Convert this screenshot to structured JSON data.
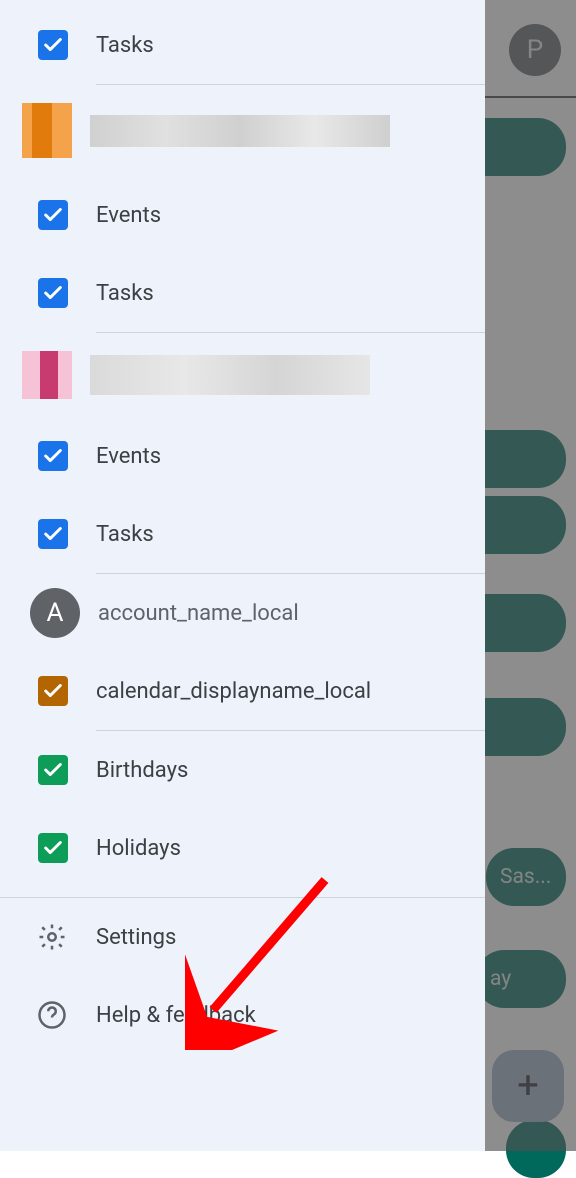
{
  "background": {
    "avatar_letter": "P",
    "pill6_text": "Sas...",
    "pill7_text": "ay",
    "fab_glyph": "+"
  },
  "drawer": {
    "items": [
      {
        "label": "Tasks",
        "checkbox_color": "blue"
      }
    ],
    "section2": {
      "items": [
        {
          "label": "Events",
          "checkbox_color": "blue"
        },
        {
          "label": "Tasks",
          "checkbox_color": "blue"
        }
      ]
    },
    "section3": {
      "items": [
        {
          "label": "Events",
          "checkbox_color": "blue"
        },
        {
          "label": "Tasks",
          "checkbox_color": "blue"
        }
      ]
    },
    "local_account": {
      "avatar_letter": "A",
      "name": "account_name_local",
      "items": [
        {
          "label": "calendar_displayname_local",
          "checkbox_color": "amber"
        }
      ]
    },
    "other": {
      "items": [
        {
          "label": "Birthdays",
          "checkbox_color": "green"
        },
        {
          "label": "Holidays",
          "checkbox_color": "green"
        }
      ]
    },
    "footer": {
      "settings": "Settings",
      "help": "Help & feedback"
    }
  }
}
